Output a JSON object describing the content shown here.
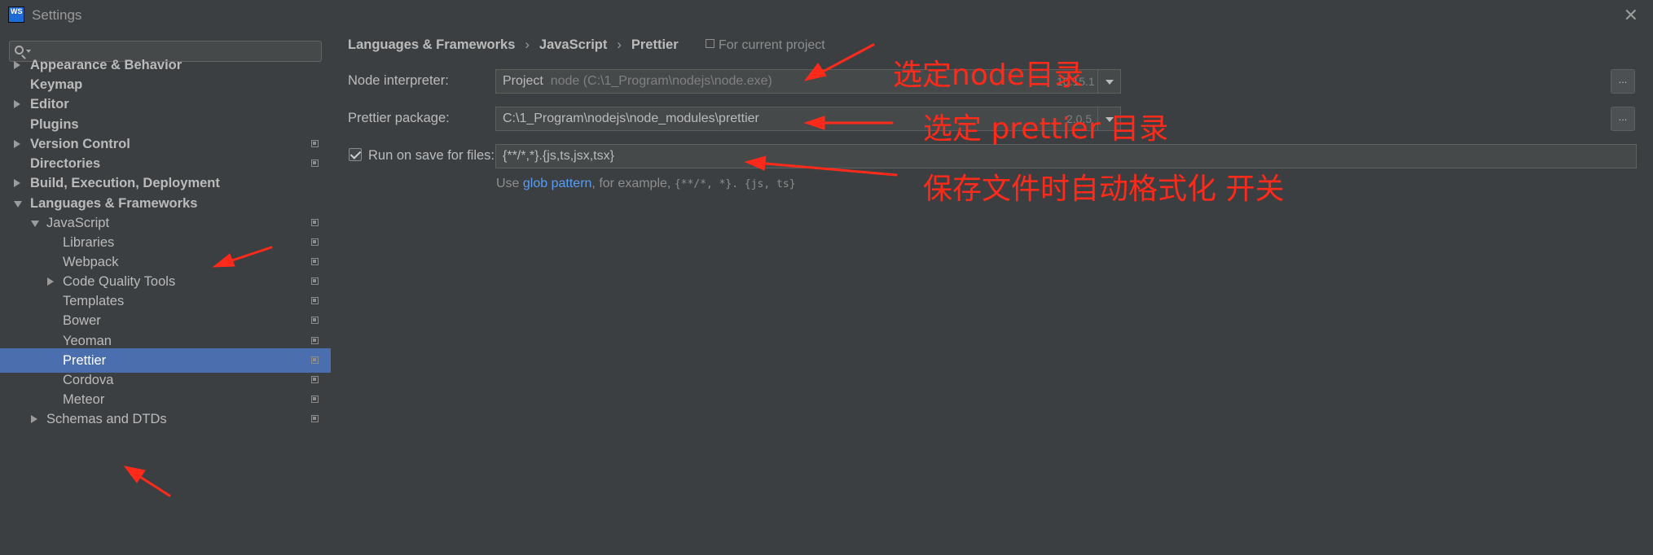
{
  "window": {
    "title": "Settings"
  },
  "sidebar": {
    "search_placeholder": "",
    "items": [
      {
        "label": "Appearance & Behavior"
      },
      {
        "label": "Keymap"
      },
      {
        "label": "Editor"
      },
      {
        "label": "Plugins"
      },
      {
        "label": "Version Control"
      },
      {
        "label": "Directories"
      },
      {
        "label": "Build, Execution, Deployment"
      },
      {
        "label": "Languages & Frameworks"
      },
      {
        "label": "JavaScript"
      },
      {
        "label": "Libraries"
      },
      {
        "label": "Webpack"
      },
      {
        "label": "Code Quality Tools"
      },
      {
        "label": "Templates"
      },
      {
        "label": "Bower"
      },
      {
        "label": "Yeoman"
      },
      {
        "label": "Prettier"
      },
      {
        "label": "Cordova"
      },
      {
        "label": "Meteor"
      },
      {
        "label": "Schemas and DTDs"
      }
    ]
  },
  "breadcrumb": {
    "items": [
      "Languages & Frameworks",
      "JavaScript",
      "Prettier"
    ],
    "separator": "›"
  },
  "scope_label": "For current project",
  "node_interpreter": {
    "label": "Node interpreter:",
    "scope": "Project",
    "value": "node (C:\\1_Program\\nodejs\\node.exe)",
    "version": "10.15.1",
    "browse": "..."
  },
  "prettier_package": {
    "label": "Prettier package:",
    "value": "C:\\1_Program\\nodejs\\node_modules\\prettier",
    "version": "2.0.5",
    "browse": "..."
  },
  "run_on_save": {
    "label": "Run on save for files:",
    "checked": true,
    "value": "{**/*,*}.{js,ts,jsx,tsx}"
  },
  "hint": {
    "prefix": "Use",
    "link": "glob pattern",
    "middle": ", for example,",
    "example": "{**/*, *}. {js, ts}"
  },
  "annotations": {
    "node_dir": "选定node目录",
    "prettier_dir": "选定 prettier 目录",
    "format_on_save": "保存文件时自动格式化 开关"
  },
  "colors": {
    "background": "#3c3f41",
    "selection": "#4b6eaf",
    "link": "#589df6",
    "annotation": "#ff2a1a"
  }
}
